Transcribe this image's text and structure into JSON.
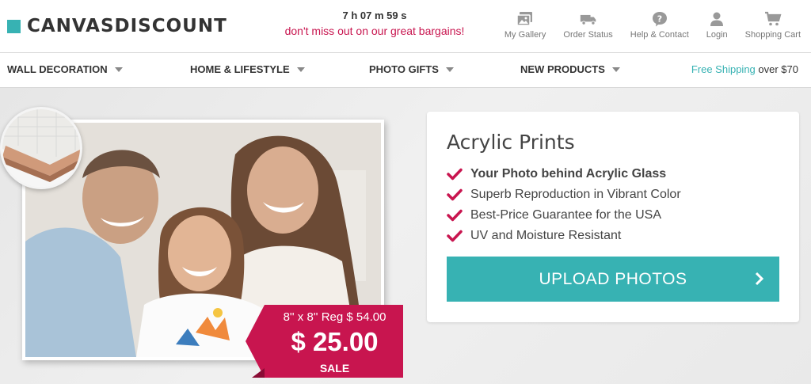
{
  "brand": {
    "name": "CANVASDISCOUNT",
    "accent": "#37b2b3"
  },
  "promo": {
    "timer": "7 h 07 m 59 s",
    "message": "don't miss out on our great bargains!"
  },
  "header_links": [
    {
      "label": "My Gallery",
      "icon": "gallery-icon"
    },
    {
      "label": "Order Status",
      "icon": "truck-icon"
    },
    {
      "label": "Help & Contact",
      "icon": "help-icon"
    },
    {
      "label": "Login",
      "icon": "user-icon"
    },
    {
      "label": "Shopping Cart",
      "icon": "cart-icon"
    }
  ],
  "nav": {
    "items": [
      {
        "label": "WALL DECORATION"
      },
      {
        "label": "HOME & LIFESTYLE"
      },
      {
        "label": "PHOTO GIFTS"
      },
      {
        "label": "NEW PRODUCTS"
      }
    ],
    "shipping_highlight": "Free Shipping",
    "shipping_rest": " over $70"
  },
  "hero": {
    "price_tag": {
      "size_reg": "8'' x 8'' Reg $ 54.00",
      "price": "$ 25.00",
      "sale": "SALE",
      "color": "#c8154f"
    }
  },
  "card": {
    "title": "Acrylic Prints",
    "features": [
      "Your Photo behind Acrylic Glass",
      "Superb Reproduction in Vibrant Color",
      "Best-Price Guarantee for the USA",
      "UV and Moisture Resistant"
    ],
    "cta": "UPLOAD PHOTOS"
  }
}
